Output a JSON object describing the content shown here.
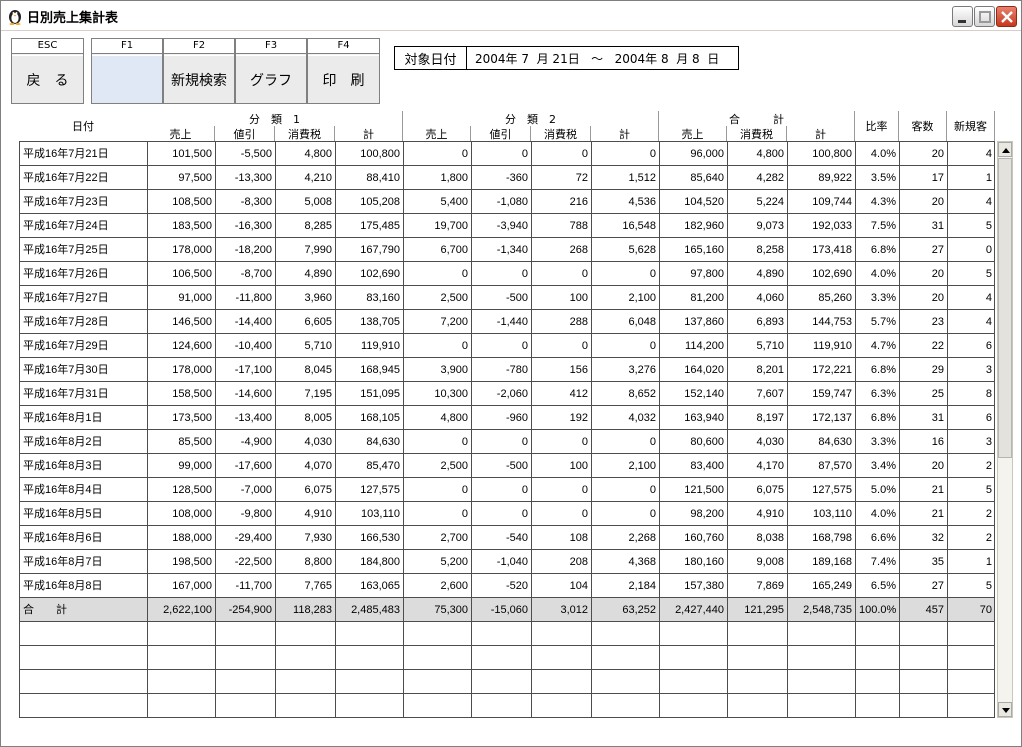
{
  "window": {
    "title": "日別売上集計表"
  },
  "fkeys": [
    {
      "key": "ESC",
      "label": "戻　る"
    },
    {
      "key": "F1",
      "label": ""
    },
    {
      "key": "F2",
      "label": "新規検索"
    },
    {
      "key": "F3",
      "label": "グラフ"
    },
    {
      "key": "F4",
      "label": "印　刷"
    }
  ],
  "date_range": {
    "label": "対象日付",
    "value": "2004年 7  月 21日   〜   2004年 8  月 8  日"
  },
  "header": {
    "date": "日付",
    "group1": "分　類　1",
    "group2": "分　類　2",
    "group3": "合　　　計",
    "sales": "売上",
    "discount": "値引",
    "tax": "消費税",
    "total": "計",
    "ratio": "比率",
    "customers": "客数",
    "new_customers": "新規客"
  },
  "rows": [
    [
      "平成16年7月21日",
      "101,500",
      "-5,500",
      "4,800",
      "100,800",
      "0",
      "0",
      "0",
      "0",
      "96,000",
      "4,800",
      "100,800",
      "4.0%",
      "20",
      "4"
    ],
    [
      "平成16年7月22日",
      "97,500",
      "-13,300",
      "4,210",
      "88,410",
      "1,800",
      "-360",
      "72",
      "1,512",
      "85,640",
      "4,282",
      "89,922",
      "3.5%",
      "17",
      "1"
    ],
    [
      "平成16年7月23日",
      "108,500",
      "-8,300",
      "5,008",
      "105,208",
      "5,400",
      "-1,080",
      "216",
      "4,536",
      "104,520",
      "5,224",
      "109,744",
      "4.3%",
      "20",
      "4"
    ],
    [
      "平成16年7月24日",
      "183,500",
      "-16,300",
      "8,285",
      "175,485",
      "19,700",
      "-3,940",
      "788",
      "16,548",
      "182,960",
      "9,073",
      "192,033",
      "7.5%",
      "31",
      "5"
    ],
    [
      "平成16年7月25日",
      "178,000",
      "-18,200",
      "7,990",
      "167,790",
      "6,700",
      "-1,340",
      "268",
      "5,628",
      "165,160",
      "8,258",
      "173,418",
      "6.8%",
      "27",
      "0"
    ],
    [
      "平成16年7月26日",
      "106,500",
      "-8,700",
      "4,890",
      "102,690",
      "0",
      "0",
      "0",
      "0",
      "97,800",
      "4,890",
      "102,690",
      "4.0%",
      "20",
      "5"
    ],
    [
      "平成16年7月27日",
      "91,000",
      "-11,800",
      "3,960",
      "83,160",
      "2,500",
      "-500",
      "100",
      "2,100",
      "81,200",
      "4,060",
      "85,260",
      "3.3%",
      "20",
      "4"
    ],
    [
      "平成16年7月28日",
      "146,500",
      "-14,400",
      "6,605",
      "138,705",
      "7,200",
      "-1,440",
      "288",
      "6,048",
      "137,860",
      "6,893",
      "144,753",
      "5.7%",
      "23",
      "4"
    ],
    [
      "平成16年7月29日",
      "124,600",
      "-10,400",
      "5,710",
      "119,910",
      "0",
      "0",
      "0",
      "0",
      "114,200",
      "5,710",
      "119,910",
      "4.7%",
      "22",
      "6"
    ],
    [
      "平成16年7月30日",
      "178,000",
      "-17,100",
      "8,045",
      "168,945",
      "3,900",
      "-780",
      "156",
      "3,276",
      "164,020",
      "8,201",
      "172,221",
      "6.8%",
      "29",
      "3"
    ],
    [
      "平成16年7月31日",
      "158,500",
      "-14,600",
      "7,195",
      "151,095",
      "10,300",
      "-2,060",
      "412",
      "8,652",
      "152,140",
      "7,607",
      "159,747",
      "6.3%",
      "25",
      "8"
    ],
    [
      "平成16年8月1日",
      "173,500",
      "-13,400",
      "8,005",
      "168,105",
      "4,800",
      "-960",
      "192",
      "4,032",
      "163,940",
      "8,197",
      "172,137",
      "6.8%",
      "31",
      "6"
    ],
    [
      "平成16年8月2日",
      "85,500",
      "-4,900",
      "4,030",
      "84,630",
      "0",
      "0",
      "0",
      "0",
      "80,600",
      "4,030",
      "84,630",
      "3.3%",
      "16",
      "3"
    ],
    [
      "平成16年8月3日",
      "99,000",
      "-17,600",
      "4,070",
      "85,470",
      "2,500",
      "-500",
      "100",
      "2,100",
      "83,400",
      "4,170",
      "87,570",
      "3.4%",
      "20",
      "2"
    ],
    [
      "平成16年8月4日",
      "128,500",
      "-7,000",
      "6,075",
      "127,575",
      "0",
      "0",
      "0",
      "0",
      "121,500",
      "6,075",
      "127,575",
      "5.0%",
      "21",
      "5"
    ],
    [
      "平成16年8月5日",
      "108,000",
      "-9,800",
      "4,910",
      "103,110",
      "0",
      "0",
      "0",
      "0",
      "98,200",
      "4,910",
      "103,110",
      "4.0%",
      "21",
      "2"
    ],
    [
      "平成16年8月6日",
      "188,000",
      "-29,400",
      "7,930",
      "166,530",
      "2,700",
      "-540",
      "108",
      "2,268",
      "160,760",
      "8,038",
      "168,798",
      "6.6%",
      "32",
      "2"
    ],
    [
      "平成16年8月7日",
      "198,500",
      "-22,500",
      "8,800",
      "184,800",
      "5,200",
      "-1,040",
      "208",
      "4,368",
      "180,160",
      "9,008",
      "189,168",
      "7.4%",
      "35",
      "1"
    ],
    [
      "平成16年8月8日",
      "167,000",
      "-11,700",
      "7,765",
      "163,065",
      "2,600",
      "-520",
      "104",
      "2,184",
      "157,380",
      "7,869",
      "165,249",
      "6.5%",
      "27",
      "5"
    ]
  ],
  "total_row": [
    "合　　計",
    "2,622,100",
    "-254,900",
    "118,283",
    "2,485,483",
    "75,300",
    "-15,060",
    "3,012",
    "63,252",
    "2,427,440",
    "121,295",
    "2,548,735",
    "100.0%",
    "457",
    "70"
  ],
  "empty_rows": 4
}
